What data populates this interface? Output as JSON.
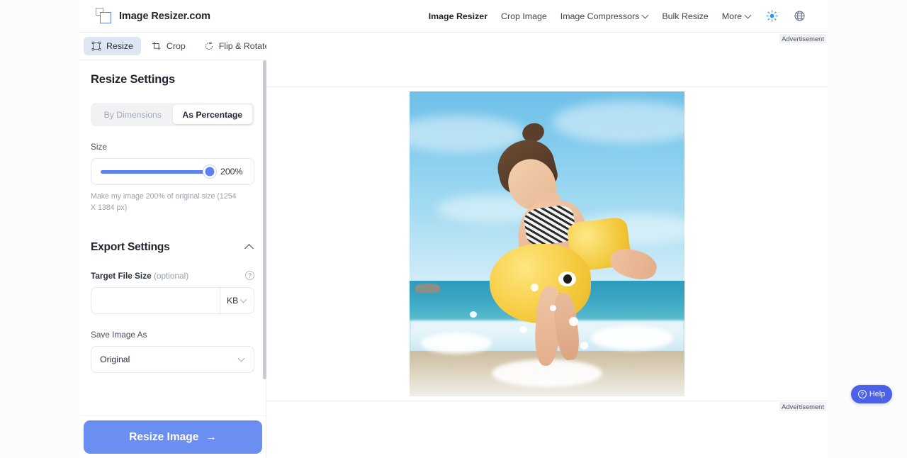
{
  "brand": {
    "name": "Image Resizer.com",
    "logo_icon": "overlapping-squares-logo",
    "green_hex": "#7dc242",
    "blue_hex": "#5b83f0"
  },
  "nav": {
    "items": [
      {
        "label": "Image Resizer",
        "active": true,
        "has_caret": false
      },
      {
        "label": "Crop Image",
        "active": false,
        "has_caret": false
      },
      {
        "label": "Image Compressors",
        "active": false,
        "has_caret": true
      },
      {
        "label": "Bulk Resize",
        "active": false,
        "has_caret": false
      },
      {
        "label": "More",
        "active": false,
        "has_caret": true
      }
    ],
    "theme_icon": "sun-icon",
    "theme_icon_hex": "#2196f3",
    "language_icon": "globe-icon"
  },
  "tabs": [
    {
      "label": "Resize",
      "icon": "resize-handles-icon",
      "active": true
    },
    {
      "label": "Crop",
      "icon": "crop-icon",
      "active": false
    },
    {
      "label": "Flip & Rotate",
      "icon": "rotate-icon",
      "active": false
    }
  ],
  "panel": {
    "title": "Resize Settings",
    "mode_toggle": {
      "options": [
        "By Dimensions",
        "As Percentage"
      ],
      "selected": "As Percentage"
    },
    "size": {
      "label": "Size",
      "value_label": "200%",
      "percent": 200,
      "slider_min": 1,
      "slider_max": 205,
      "fill_percent": 97,
      "helper": "Make my image 200% of original size (1254 X 1384 px)"
    },
    "export": {
      "title": "Export Settings",
      "collapse_icon": "chevron-up-icon",
      "target_file_size": {
        "label": "Target File Size",
        "optional_suffix": "(optional)",
        "help_icon": "question-mark-icon",
        "value": "",
        "placeholder": "",
        "unit": "KB",
        "unit_caret": "chevron-down-icon"
      },
      "save_image_as": {
        "label": "Save Image As",
        "value": "Original",
        "caret": "chevron-down-icon"
      }
    }
  },
  "cta": {
    "label": "Resize Image",
    "arrow": "→",
    "bg_hex": "#6b8ef2"
  },
  "canvas": {
    "ad_label_top": "Advertisement",
    "ad_label_bottom": "Advertisement",
    "preview_alt": "child-with-yellow-duck-float-at-beach"
  },
  "help_widget": {
    "label": "Help",
    "icon": "question-circle-icon",
    "bg_hex": "#4a61e8"
  }
}
